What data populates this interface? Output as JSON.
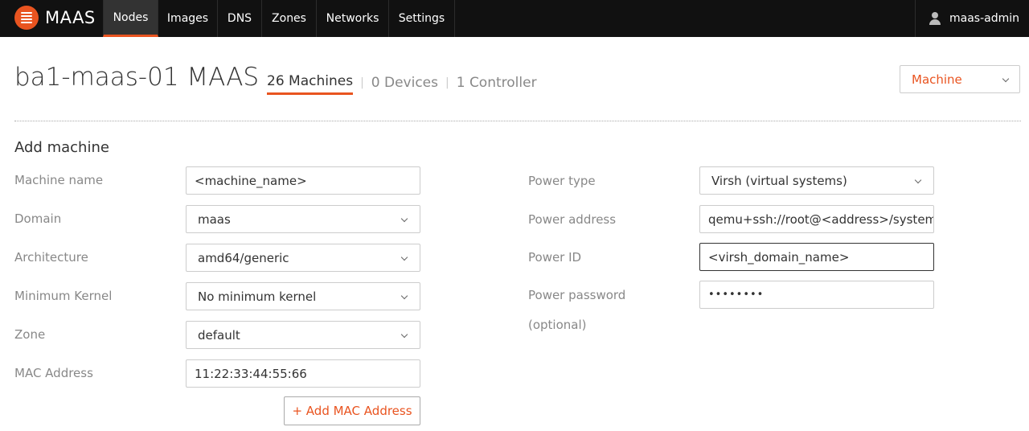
{
  "nav": {
    "brand": "MAAS",
    "tabs": [
      {
        "label": "Nodes",
        "active": true
      },
      {
        "label": "Images",
        "active": false
      },
      {
        "label": "DNS",
        "active": false
      },
      {
        "label": "Zones",
        "active": false
      },
      {
        "label": "Networks",
        "active": false
      },
      {
        "label": "Settings",
        "active": false
      }
    ],
    "user": "maas-admin"
  },
  "header": {
    "title": "ba1-maas-01 MAAS",
    "machines": "26 Machines",
    "devices": "0 Devices",
    "controllers": "1 Controller",
    "type_select": "Machine"
  },
  "form": {
    "title": "Add machine",
    "machine_name": {
      "label": "Machine name",
      "value": "<machine_name>"
    },
    "domain": {
      "label": "Domain",
      "value": "maas"
    },
    "architecture": {
      "label": "Architecture",
      "value": "amd64/generic"
    },
    "min_kernel": {
      "label": "Minimum Kernel",
      "value": "No minimum kernel"
    },
    "zone": {
      "label": "Zone",
      "value": "default"
    },
    "mac_address": {
      "label": "MAC Address",
      "value": "11:22:33:44:55:66"
    },
    "add_mac_button": "+ Add MAC Address",
    "power_type": {
      "label": "Power type",
      "value": "Virsh (virtual systems)"
    },
    "power_address": {
      "label": "Power address",
      "value": "qemu+ssh://root@<address>/system"
    },
    "power_id": {
      "label": "Power ID",
      "value": "<virsh_domain_name>"
    },
    "power_password": {
      "label": "Power password",
      "label_optional": "(optional)",
      "value": "••••••••"
    }
  },
  "colors": {
    "accent": "#e95420",
    "navbar": "#111111"
  }
}
